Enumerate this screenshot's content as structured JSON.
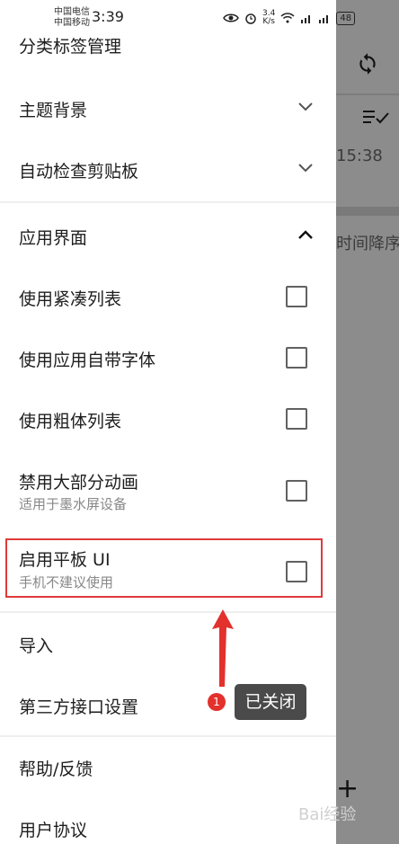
{
  "status_bar": {
    "carrier_1": "中国电信",
    "carrier_2": "中国移动",
    "time": "3:39",
    "speed_value": "3.4",
    "speed_unit": "K/s",
    "battery": "48"
  },
  "background": {
    "time_text": "15:38",
    "sort_text": "时间降序",
    "add_symbol": "+"
  },
  "menu": {
    "category_tags": "分类标签管理",
    "theme_background": "主题背景",
    "auto_clipboard": "自动检查剪贴板",
    "app_interface": "应用界面",
    "compact_list": "使用紧凑列表",
    "app_font": "使用应用自带字体",
    "bold_list": "使用粗体列表",
    "disable_animation": "禁用大部分动画",
    "disable_animation_sub": "适用于墨水屏设备",
    "tablet_ui": "启用平板 UI",
    "tablet_ui_sub": "手机不建议使用",
    "import": "导入",
    "third_party": "第三方接口设置",
    "help": "帮助/反馈",
    "user_agreement": "用户协议"
  },
  "checkboxes": {
    "compact_list": false,
    "app_font": false,
    "bold_list": false,
    "disable_animation": false,
    "tablet_ui": false
  },
  "annotation": {
    "badge_number": "1",
    "tooltip": "已关闭",
    "highlight_color": "#e03a3a"
  },
  "watermark": "Bai经验"
}
